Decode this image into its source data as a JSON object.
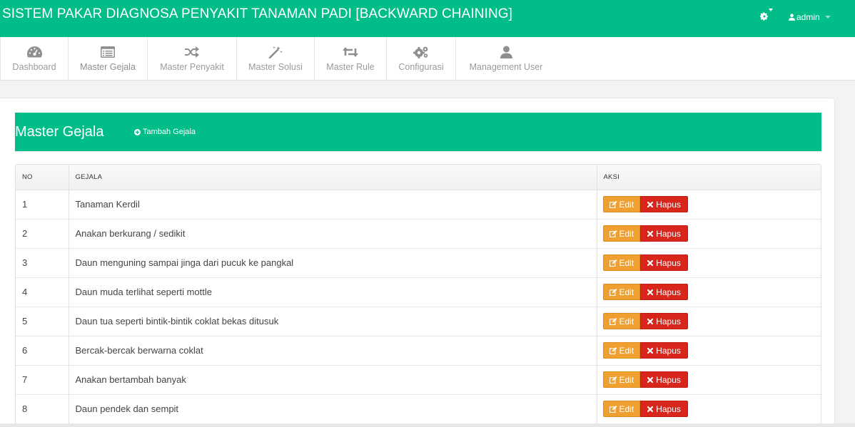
{
  "header": {
    "title": "SISTEM PAKAR DIAGNOSA PENYAKIT TANAMAN PADI [BACKWARD CHAINING]",
    "user": "admin",
    "settings_icon": "gear-icon",
    "user_icon": "user-icon"
  },
  "nav": {
    "items": [
      {
        "label": "Dashboard",
        "icon": "dashboard-icon"
      },
      {
        "label": "Master Gejala",
        "icon": "list-icon"
      },
      {
        "label": "Master Penyakit",
        "icon": "shuffle-icon"
      },
      {
        "label": "Master Solusi",
        "icon": "magic-wand-icon"
      },
      {
        "label": "Master Rule",
        "icon": "retweet-icon"
      },
      {
        "label": "Configurasi",
        "icon": "gears-icon"
      },
      {
        "label": "Management User",
        "icon": "user-icon"
      }
    ]
  },
  "page": {
    "title": "Master Gejala",
    "add_label": "Tambah Gejala"
  },
  "table": {
    "headers": [
      "NO",
      "GEJALA",
      "AKSI"
    ],
    "edit_label": "Edit",
    "delete_label": "Hapus",
    "rows": [
      {
        "no": "1",
        "gejala": "Tanaman Kerdil"
      },
      {
        "no": "2",
        "gejala": "Anakan berkurang / sedikit"
      },
      {
        "no": "3",
        "gejala": "Daun menguning sampai jinga dari pucuk ke pangkal"
      },
      {
        "no": "4",
        "gejala": "Daun muda terlihat seperti mottle"
      },
      {
        "no": "5",
        "gejala": "Daun tua seperti bintik-bintik coklat bekas ditusuk"
      },
      {
        "no": "6",
        "gejala": "Bercak-bercak berwarna coklat"
      },
      {
        "no": "7",
        "gejala": "Anakan bertambah banyak"
      },
      {
        "no": "8",
        "gejala": "Daun pendek dan sempit"
      }
    ]
  },
  "colors": {
    "brand": "#00bd8a",
    "edit": "#f0a030",
    "delete": "#d8261c"
  }
}
